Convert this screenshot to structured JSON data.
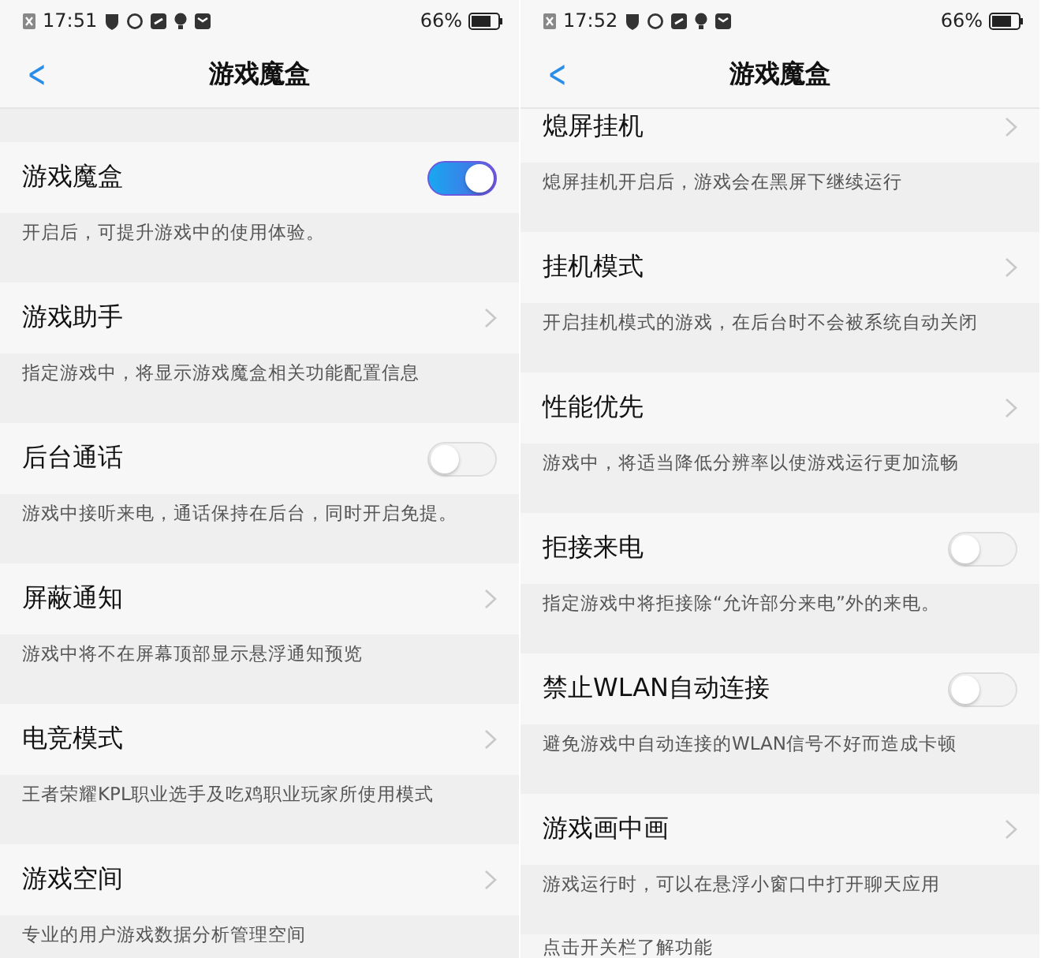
{
  "screens": [
    {
      "status_bar": {
        "time": "17:51",
        "battery": "66%"
      },
      "header": {
        "back": "<",
        "title": "游戏魔盒"
      },
      "items": [
        {
          "kind": "toggle",
          "title": "游戏魔盒",
          "on": true,
          "description": "开启后，可提升游戏中的使用体验。"
        },
        {
          "kind": "link",
          "title": "游戏助手",
          "description": "指定游戏中，将显示游戏魔盒相关功能配置信息"
        },
        {
          "kind": "toggle",
          "title": "后台通话",
          "on": false,
          "description": "游戏中接听来电，通话保持在后台，同时开启免提。"
        },
        {
          "kind": "link",
          "title": "屏蔽通知",
          "description": "游戏中将不在屏幕顶部显示悬浮通知预览"
        },
        {
          "kind": "link",
          "title": "电竞模式",
          "description": "王者荣耀KPL职业选手及吃鸡职业玩家所使用模式"
        },
        {
          "kind": "link",
          "title": "游戏空间",
          "description": "专业的用户游戏数据分析管理空间"
        }
      ]
    },
    {
      "status_bar": {
        "time": "17:52",
        "battery": "66%"
      },
      "header": {
        "back": "<",
        "title": "游戏魔盒"
      },
      "scrolled": true,
      "footer": "点击开关栏了解功能",
      "items": [
        {
          "kind": "link",
          "title": "熄屏挂机",
          "description": "熄屏挂机开启后，游戏会在黑屏下继续运行"
        },
        {
          "kind": "link",
          "title": "挂机模式",
          "description": "开启挂机模式的游戏，在后台时不会被系统自动关闭"
        },
        {
          "kind": "link",
          "title": "性能优先",
          "description": "游戏中，将适当降低分辨率以使游戏运行更加流畅"
        },
        {
          "kind": "toggle",
          "title": "拒接来电",
          "on": false,
          "description": "指定游戏中将拒接除“允许部分来电”外的来电。"
        },
        {
          "kind": "toggle",
          "title": "禁止WLAN自动连接",
          "on": false,
          "description": "避免游戏中自动连接的WLAN信号不好而造成卡顿"
        },
        {
          "kind": "link",
          "title": "游戏画中画",
          "description": "游戏运行时，可以在悬浮小窗口中打开聊天应用"
        }
      ]
    }
  ]
}
